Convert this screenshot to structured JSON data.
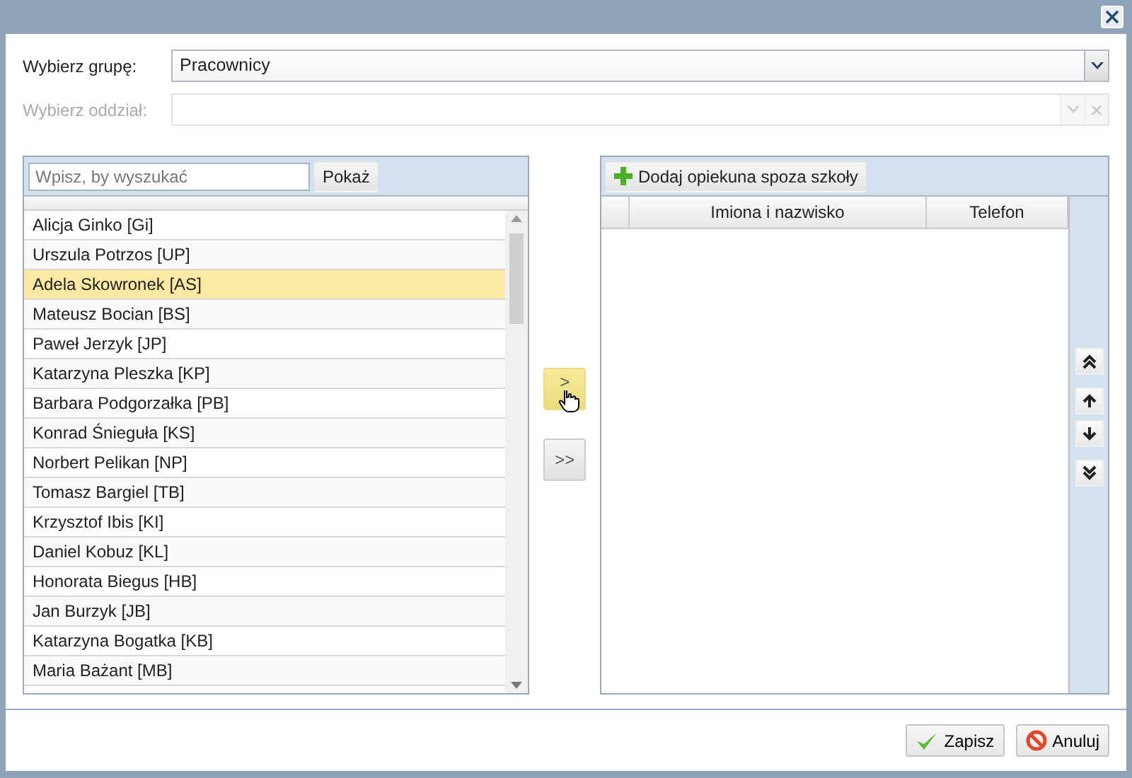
{
  "fields": [
    {
      "label": "Wybierz grupę:",
      "value": "Pracownicy",
      "disabled": false
    },
    {
      "label": "Wybierz oddział:",
      "disabled": true
    }
  ],
  "left_panel": {
    "search": {
      "placeholder": "Wpisz, by wyszukać"
    },
    "show_button": "Pokaż",
    "rows": [
      {
        "name": "Alicja Ginko [Gi]",
        "selected": false
      },
      {
        "name": "Urszula Potrzos [UP]",
        "selected": false
      },
      {
        "name": "Adela Skowronek [AS]",
        "selected": true
      },
      {
        "name": "Mateusz Bocian [BS]",
        "selected": false
      },
      {
        "name": "Paweł Jerzyk [JP]",
        "selected": false
      },
      {
        "name": "Katarzyna Pleszka [KP]",
        "selected": false
      },
      {
        "name": "Barbara Podgorzałka [PB]",
        "selected": false
      },
      {
        "name": "Konrad Śnieguła [KS]",
        "selected": false
      },
      {
        "name": "Norbert Pelikan [NP]",
        "selected": false
      },
      {
        "name": "Tomasz Bargiel [TB]",
        "selected": false
      },
      {
        "name": "Krzysztof Ibis [KI]",
        "selected": false
      },
      {
        "name": "Daniel Kobuz [KL]",
        "selected": false
      },
      {
        "name": "Honorata Biegus [HB]",
        "selected": false
      },
      {
        "name": "Jan Burzyk [JB]",
        "selected": false
      },
      {
        "name": "Katarzyna Bogatka [KB]",
        "selected": false
      },
      {
        "name": "Maria Bażant [MB]",
        "selected": false
      }
    ]
  },
  "transfer_buttons": [
    {
      "label": ">",
      "hovered": true
    },
    {
      "label": ">>",
      "hovered": false
    }
  ],
  "right_panel": {
    "add_button": "Dodaj opiekuna spoza szkoły",
    "columns": [
      "Imiona i nazwisko",
      "Telefon"
    ]
  },
  "footer_buttons": [
    {
      "label": "Zapisz",
      "kind": "save"
    },
    {
      "label": "Anuluj",
      "kind": "cancel"
    }
  ]
}
